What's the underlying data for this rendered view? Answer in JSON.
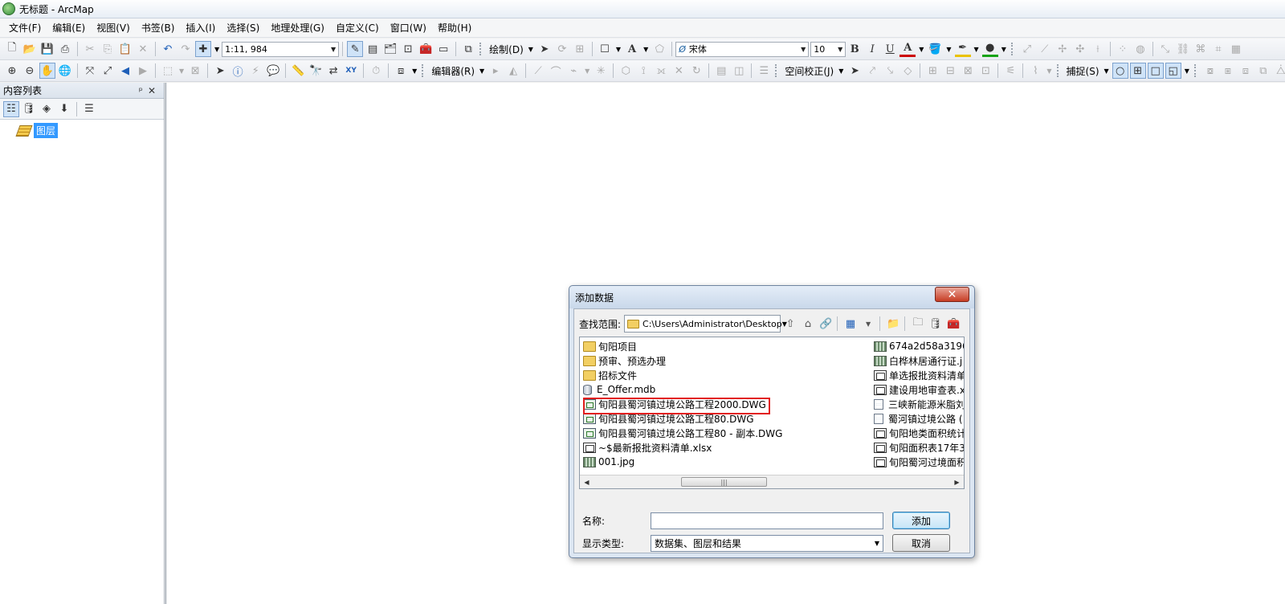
{
  "window": {
    "title": "无标题 - ArcMap"
  },
  "menu": [
    "文件(F)",
    "编辑(E)",
    "视图(V)",
    "书签(B)",
    "插入(I)",
    "选择(S)",
    "地理处理(G)",
    "自定义(C)",
    "窗口(W)",
    "帮助(H)"
  ],
  "toolbar1": {
    "scale": "1:11, 984",
    "draw_label": "绘制(D)",
    "font_name": "宋体",
    "font_size": "10",
    "bold": "B",
    "italic": "I",
    "underline": "U",
    "font_color": "A"
  },
  "toolbar2": {
    "editor_label": "编辑器(R)",
    "spatial_adjust_label": "空间校正(J)",
    "snapping_label": "捕捉(S)"
  },
  "toc": {
    "title": "内容列表",
    "pin": "ᵖ",
    "close": "✕",
    "layer": "图层"
  },
  "dialog": {
    "title": "添加数据",
    "close": "✕",
    "look_in_label": "查找范围:",
    "look_in_path": "C:\\Users\\Administrator\\Desktop",
    "files_left": [
      {
        "name": "旬阳项目",
        "icon": "folder-icon",
        "kind": "folder"
      },
      {
        "name": "预审、预选办理",
        "icon": "folder-icon",
        "kind": "folder"
      },
      {
        "name": "招标文件",
        "icon": "folder-icon",
        "kind": "folder"
      },
      {
        "name": "E_Offer.mdb",
        "icon": "database-icon",
        "kind": "db"
      },
      {
        "name": "旬阳县蜀河镇过境公路工程2000.DWG",
        "icon": "cad-icon",
        "kind": "cad"
      },
      {
        "name": "旬阳县蜀河镇过境公路工程80.DWG",
        "icon": "cad-icon",
        "kind": "cad"
      },
      {
        "name": "旬阳县蜀河镇过境公路工程80 - 副本.DWG",
        "icon": "cad-icon",
        "kind": "cad"
      },
      {
        "name": "~$最新报批资料清单.xlsx",
        "icon": "table-icon",
        "kind": "tbl"
      },
      {
        "name": "001.jpg",
        "icon": "raster-icon",
        "kind": "raster"
      }
    ],
    "files_right": [
      {
        "name": "674a2d58a3196",
        "icon": "raster-icon",
        "kind": "raster"
      },
      {
        "name": "白桦林居通行证.j",
        "icon": "raster-icon",
        "kind": "raster"
      },
      {
        "name": "单选报批资料清单",
        "icon": "table-icon",
        "kind": "tbl"
      },
      {
        "name": "建设用地审查表.x",
        "icon": "table-icon",
        "kind": "tbl"
      },
      {
        "name": "三峡新能源米脂刘",
        "icon": "document-icon",
        "kind": "doc"
      },
      {
        "name": "蜀河镇过境公路 (",
        "icon": "document-icon",
        "kind": "doc"
      },
      {
        "name": "旬阳地类面积统计",
        "icon": "table-icon",
        "kind": "tbl"
      },
      {
        "name": "旬阳面积表17年3",
        "icon": "table-icon",
        "kind": "tbl"
      },
      {
        "name": "旬阳蜀河过境面积",
        "icon": "table-icon",
        "kind": "tbl"
      }
    ],
    "name_label": "名称:",
    "name_value": "",
    "type_label": "显示类型:",
    "type_value": "数据集、图层和结果",
    "add_button": "添加",
    "cancel_button": "取消"
  },
  "colors": {
    "highlight": "#e21e1e",
    "selection": "#3399ff",
    "close_button": "#c73d24"
  }
}
